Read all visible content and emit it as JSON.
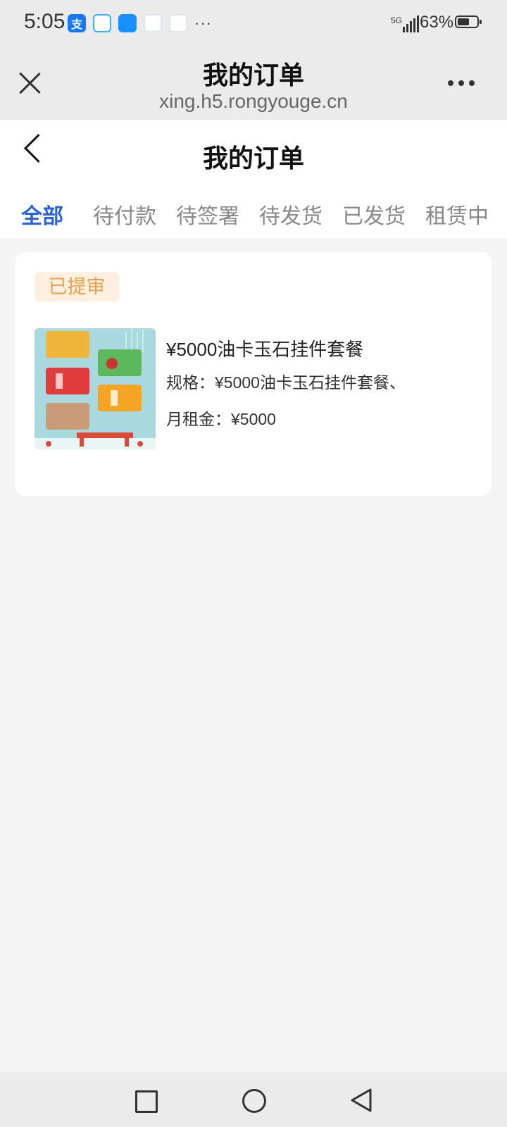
{
  "status_bar": {
    "time": "5:05",
    "more": "···",
    "signal_label": "5G",
    "battery_percent": "63%",
    "battery_level": 0.63,
    "app_icons": [
      "alipay-icon",
      "chat-icon",
      "message-icon",
      "baidu-icon",
      "baidu-icon"
    ]
  },
  "browser": {
    "title": "我的订单",
    "url": "xing.h5.rongyouge.cn"
  },
  "page": {
    "title": "我的订单",
    "tabs": [
      {
        "label": "全部",
        "active": true
      },
      {
        "label": "待付款",
        "active": false
      },
      {
        "label": "待签署",
        "active": false
      },
      {
        "label": "待发货",
        "active": false
      },
      {
        "label": "已发货",
        "active": false
      },
      {
        "label": "租赁中",
        "active": false
      }
    ]
  },
  "orders": [
    {
      "status": "已提审",
      "product_name": "¥5000油卡玉石挂件套餐",
      "spec": "规格：¥5000油卡玉石挂件套餐、",
      "rent": "月租金：¥5000"
    }
  ],
  "colors": {
    "accent": "#2a63d8",
    "badge_text": "#e8a04b",
    "badge_bg": "#fdf0e1"
  }
}
